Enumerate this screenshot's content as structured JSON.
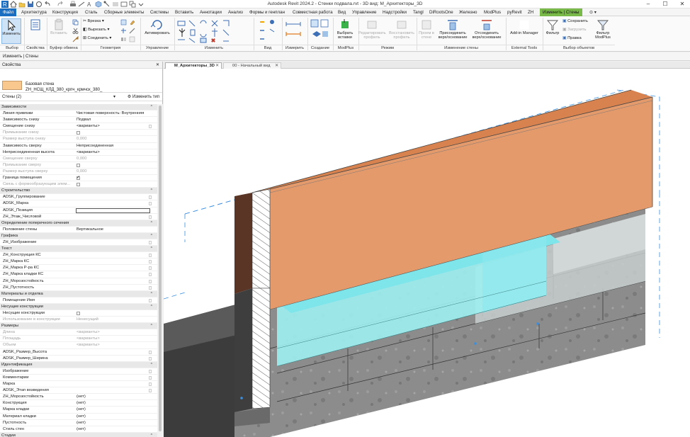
{
  "window": {
    "title": "Autodesk Revit 2024.2 - Стенки подвала.rvt - 3D вид: М_Архитекторы_3D"
  },
  "tabs": [
    {
      "label": "Файл"
    },
    {
      "label": "Архитектура"
    },
    {
      "label": "Конструкция"
    },
    {
      "label": "Сталь"
    },
    {
      "label": "Сборные элементы"
    },
    {
      "label": "Системы"
    },
    {
      "label": "Вставить"
    },
    {
      "label": "Аннотации"
    },
    {
      "label": "Анализ"
    },
    {
      "label": "Формы и генплан"
    },
    {
      "label": "Совместная работа"
    },
    {
      "label": "Вид"
    },
    {
      "label": "Управление"
    },
    {
      "label": "Надстройки"
    },
    {
      "label": "Tangl"
    },
    {
      "label": "DiRootsOne"
    },
    {
      "label": "Железно"
    },
    {
      "label": "ModPlus"
    },
    {
      "label": "pyRevit"
    },
    {
      "label": "ZH"
    },
    {
      "label": "Изменить | Стены"
    }
  ],
  "ribbon": {
    "modify_label": "Изменить",
    "properties_label": "Свойства",
    "paste_label": "Вставить",
    "cut_label": "Врезка",
    "cut2_label": "Вырезать",
    "join_label": "Соединить",
    "activate_label": "Активировать",
    "attach_label": "Выбрать вставки",
    "edit_profile_label": "Редактировать профиль",
    "reset_profile_label": "Восстановить профиль",
    "opening_label": "Проем в стене",
    "attach_top_label": "Присоединить верх/основание",
    "detach_top_label": "Отсоединить верх/основание",
    "addin_label": "Add-in Manager",
    "filter_label": "Фильтр",
    "save_sel_label": "Сохранить",
    "load_sel_label": "Загрузить",
    "edit_sel_label": "Правка",
    "filter_mp_label": "Фильтр ModPlus",
    "groups": {
      "select": "Выбор",
      "properties": "Свойства",
      "clipboard": "Буфер обмена",
      "geometry": "Геометрия",
      "control": "Управление",
      "modify": "Изменить",
      "view": "Вид",
      "measure": "Измерить",
      "create": "Создание",
      "modplus": "ModPlus",
      "mode": "Режим",
      "modify_wall": "Изменение стены",
      "external": "External Tools",
      "selection": "Выбор объектов"
    }
  },
  "options_bar": {
    "label": "Изменить | Стены"
  },
  "properties": {
    "title": "Свойства",
    "type_family": "Базовая стена",
    "type_name": "ZH_НСЩ_КЛД_380_крпч_крмчск_380_",
    "instance_label": "Стены (2)",
    "edit_type_label": "Изменить тип",
    "rows": [
      {
        "kind": "group",
        "name": "Зависимости"
      },
      {
        "kind": "row",
        "name": "Линия привязки",
        "value": "Чистовая поверхность: Внутренняя"
      },
      {
        "kind": "row",
        "name": "Зависимость снизу",
        "value": "Подвал"
      },
      {
        "kind": "row",
        "name": "Смещение снизу",
        "value": "<варианты>",
        "edit": true
      },
      {
        "kind": "dis",
        "name": "Примыкание снизу",
        "check": false
      },
      {
        "kind": "dis",
        "name": "Размер выступа снизу",
        "value": "0,000"
      },
      {
        "kind": "row",
        "name": "Зависимость сверху",
        "value": "Неприсоединенная"
      },
      {
        "kind": "row",
        "name": "Неприсоединенная высота",
        "value": "<варианты>"
      },
      {
        "kind": "dis",
        "name": "Смещение сверху",
        "value": "0,000"
      },
      {
        "kind": "dis",
        "name": "Примыкание сверху",
        "check": false
      },
      {
        "kind": "dis",
        "name": "Размер выступа сверху",
        "value": "0,000"
      },
      {
        "kind": "row",
        "name": "Граница помещения",
        "check": true
      },
      {
        "kind": "dis",
        "name": "Связь с формообразующим элем...",
        "check": false
      },
      {
        "kind": "group",
        "name": "Строительство"
      },
      {
        "kind": "row",
        "name": "ADSK_Группирование",
        "edit": true
      },
      {
        "kind": "row",
        "name": "ADSK_Марка",
        "edit": true
      },
      {
        "kind": "row",
        "name": "ADSK_Позиция",
        "textbox": true
      },
      {
        "kind": "row",
        "name": "ZH_Этаж_Числовой",
        "edit": true
      },
      {
        "kind": "group",
        "name": "Определение поперечного сечения"
      },
      {
        "kind": "row",
        "name": "Положение стены",
        "value": "Вертикальное"
      },
      {
        "kind": "group",
        "name": "Графика"
      },
      {
        "kind": "row",
        "name": "ZH_Изображение",
        "edit": true
      },
      {
        "kind": "group",
        "name": "Текст"
      },
      {
        "kind": "row",
        "name": "ZH_Конструкция КС",
        "edit": true
      },
      {
        "kind": "row",
        "name": "ZH_Марка КС",
        "edit": true
      },
      {
        "kind": "row",
        "name": "ZH_Марка Р-ра КС",
        "edit": true
      },
      {
        "kind": "row",
        "name": "ZH_Марка кладки КС",
        "edit": true
      },
      {
        "kind": "row",
        "name": "ZH_Морозостойкость",
        "edit": true
      },
      {
        "kind": "row",
        "name": "ZH_Пустотность",
        "edit": true
      },
      {
        "kind": "group",
        "name": "Материалы и отделка"
      },
      {
        "kind": "row",
        "name": "Помещение Имя",
        "edit": true
      },
      {
        "kind": "group",
        "name": "Несущие конструкции"
      },
      {
        "kind": "row",
        "name": "Несущие конструкции",
        "check": false
      },
      {
        "kind": "dis",
        "name": "Использование в конструкции",
        "value": "Ненесущий"
      },
      {
        "kind": "group",
        "name": "Размеры"
      },
      {
        "kind": "dis",
        "name": "Длина",
        "value": "<варианты>"
      },
      {
        "kind": "dis",
        "name": "Площадь",
        "value": "<варианты>"
      },
      {
        "kind": "dis",
        "name": "Объем",
        "value": "<варианты>"
      },
      {
        "kind": "row",
        "name": "ADSK_Размер_Высота",
        "edit": true
      },
      {
        "kind": "row",
        "name": "ADSK_Размер_Ширина",
        "edit": true
      },
      {
        "kind": "group",
        "name": "Идентификация"
      },
      {
        "kind": "row",
        "name": "Изображение",
        "edit": true
      },
      {
        "kind": "row",
        "name": "Комментарии",
        "edit": true
      },
      {
        "kind": "row",
        "name": "Марка",
        "edit": true
      },
      {
        "kind": "row",
        "name": "ADSK_Этап возведения",
        "edit": true
      },
      {
        "kind": "row",
        "name": "ZH_Морозостойкость",
        "value": "(нет)"
      },
      {
        "kind": "row",
        "name": "Конструкция",
        "value": "(нет)"
      },
      {
        "kind": "row",
        "name": "Марка кладки",
        "value": "(нет)"
      },
      {
        "kind": "row",
        "name": "Материал кладки",
        "value": "(нет)"
      },
      {
        "kind": "row",
        "name": "Пустотность",
        "value": "(нет)"
      },
      {
        "kind": "row",
        "name": "Стиль стен",
        "value": "(нет)"
      },
      {
        "kind": "group",
        "name": "Стадии"
      }
    ]
  },
  "view_tabs": [
    {
      "label": "М_Архитекторы_3D",
      "active": true
    },
    {
      "label": "00 - Начальный вид",
      "active": false
    }
  ],
  "colors": {
    "accent": "#1a6ec2",
    "context_tab": "#79b94a",
    "wall_face": "#e59a6b",
    "glass": "#9ff0f2",
    "masonry": "#8a8a8a"
  }
}
